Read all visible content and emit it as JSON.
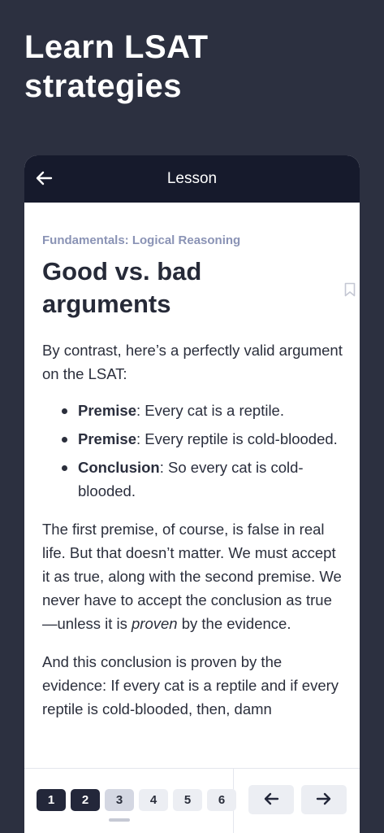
{
  "hero": {
    "title": "Learn LSAT strategies"
  },
  "header": {
    "title": "Lesson",
    "back_icon": "arrow-left-icon"
  },
  "lesson": {
    "category": "Fundamentals: Logical Reasoning",
    "title": "Good vs. bad arguments",
    "intro": "By contrast, here’s a perfectly valid argument on the LSAT:",
    "points": [
      {
        "label": "Premise",
        "text": ": Every cat is a reptile."
      },
      {
        "label": "Premise",
        "text": ": Every reptile is cold-blooded."
      },
      {
        "label": "Conclusion",
        "text": ": So every cat is cold-blooded."
      }
    ],
    "para2_before": "The first premise, of course, is false in real life. But that doesn’t matter. We must accept it as true, along with the second premise. We never have to accept the conclusion as true—unless it is ",
    "para2_emph": "proven",
    "para2_after": " by the evidence.",
    "para3": "And this conclusion is proven by the evidence: If every cat is a reptile and if every reptile is cold-blooded, then, damn"
  },
  "pagination": {
    "pages": [
      "1",
      "2",
      "3",
      "4",
      "5",
      "6"
    ],
    "current": "3"
  },
  "nav": {
    "prev_icon": "arrow-left-icon",
    "next_icon": "arrow-right-icon"
  },
  "colors": {
    "background": "#2c3040",
    "header": "#161a2c",
    "category": "#8a93b5"
  }
}
